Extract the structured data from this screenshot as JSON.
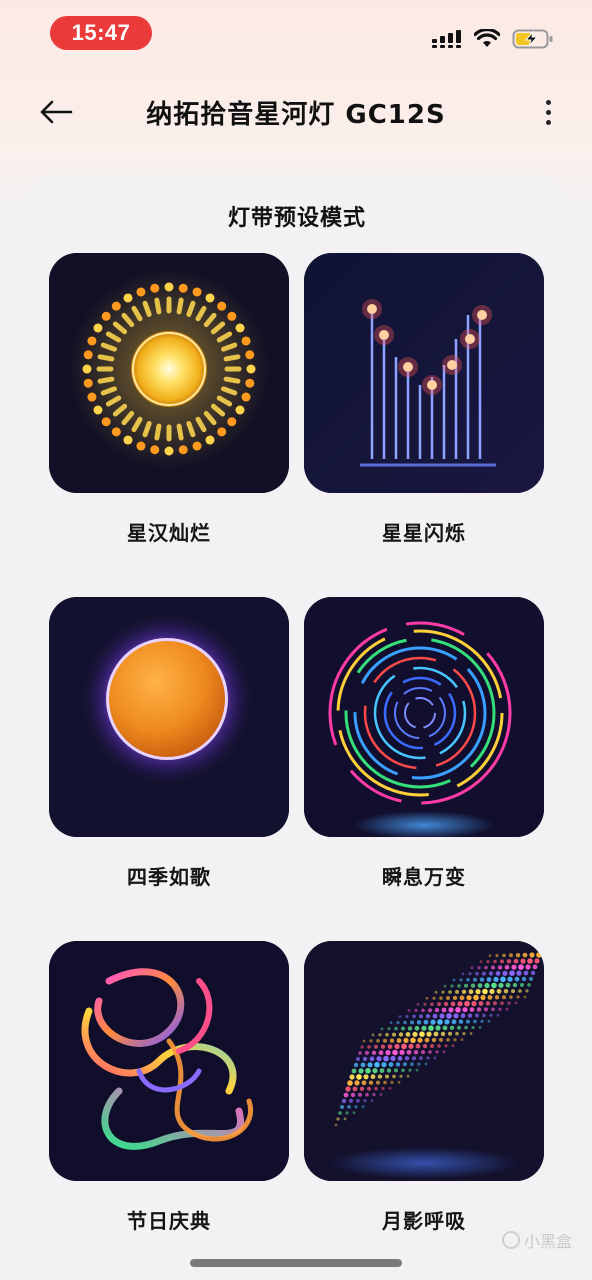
{
  "status_bar": {
    "time": "15:47",
    "icons": [
      "signal-icon",
      "wifi-icon",
      "battery-charging-icon"
    ],
    "time_pill_color": "#ea3a3a",
    "battery_color": "#f3c623"
  },
  "header": {
    "title": "纳拓拾音星河灯 GC12S",
    "back_icon": "arrow-left-icon",
    "more_icon": "more-vertical-icon"
  },
  "section": {
    "title": "灯带预设模式"
  },
  "modes": [
    {
      "label": "星汉灿烂",
      "icon": "radial-sun-icon"
    },
    {
      "label": "星星闪烁",
      "icon": "twinkle-bars-icon"
    },
    {
      "label": "四季如歌",
      "icon": "glowing-orb-icon"
    },
    {
      "label": "瞬息万变",
      "icon": "spiral-rings-icon"
    },
    {
      "label": "节日庆典",
      "icon": "ribbon-swirl-icon"
    },
    {
      "label": "月影呼吸",
      "icon": "dot-wave-icon"
    }
  ],
  "watermark": {
    "text": "小黑盒"
  }
}
